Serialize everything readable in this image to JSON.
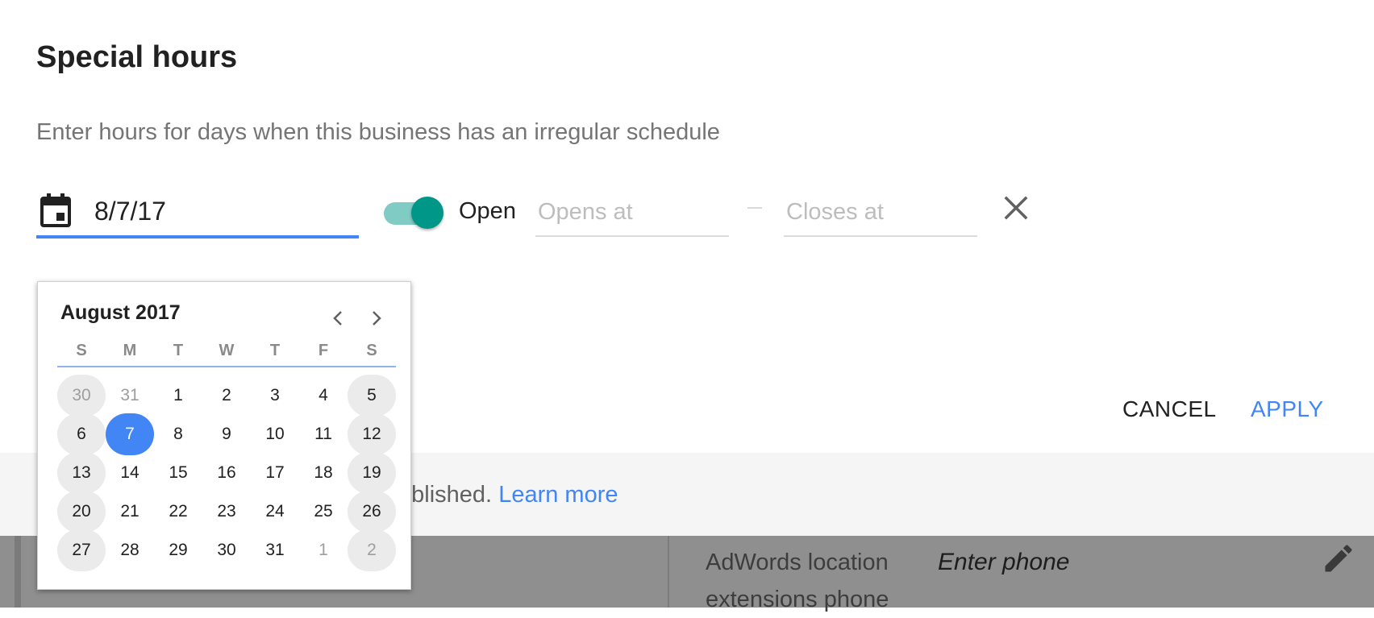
{
  "dialog": {
    "title": "Special hours",
    "subtitle": "Enter hours for days when this business has an irregular schedule",
    "date_value": "8/7/17",
    "open_label": "Open",
    "open_toggle_on": true,
    "opens_placeholder": "Opens at",
    "closes_placeholder": "Closes at",
    "cancel_label": "CANCEL",
    "apply_label": "APPLY"
  },
  "footer": {
    "text_visible": "ved for quality before being published.",
    "link": "Learn more"
  },
  "background": {
    "field_label": "AdWords location extensions phone",
    "field_placeholder": "Enter phone"
  },
  "datepicker": {
    "month_label": "August 2017",
    "weekdays": [
      "S",
      "M",
      "T",
      "W",
      "T",
      "F",
      "S"
    ],
    "weeks": [
      [
        "30",
        "31",
        "1",
        "2",
        "3",
        "4",
        "5"
      ],
      [
        "6",
        "7",
        "8",
        "9",
        "10",
        "11",
        "12"
      ],
      [
        "13",
        "14",
        "15",
        "16",
        "17",
        "18",
        "19"
      ],
      [
        "20",
        "21",
        "22",
        "23",
        "24",
        "25",
        "26"
      ],
      [
        "27",
        "28",
        "29",
        "30",
        "31",
        "1",
        "2"
      ]
    ],
    "selected_day": "7",
    "other_month_days": [
      "30",
      "31",
      "1",
      "2"
    ]
  },
  "colors": {
    "accent": "#4285f4",
    "toggle_on": "#009688",
    "weekend_bg": "#ebebeb"
  },
  "icons": {
    "date": "calendar-icon",
    "remove": "close-icon",
    "prev": "chevron-left-icon",
    "next": "chevron-right-icon",
    "edit": "pencil-icon"
  }
}
